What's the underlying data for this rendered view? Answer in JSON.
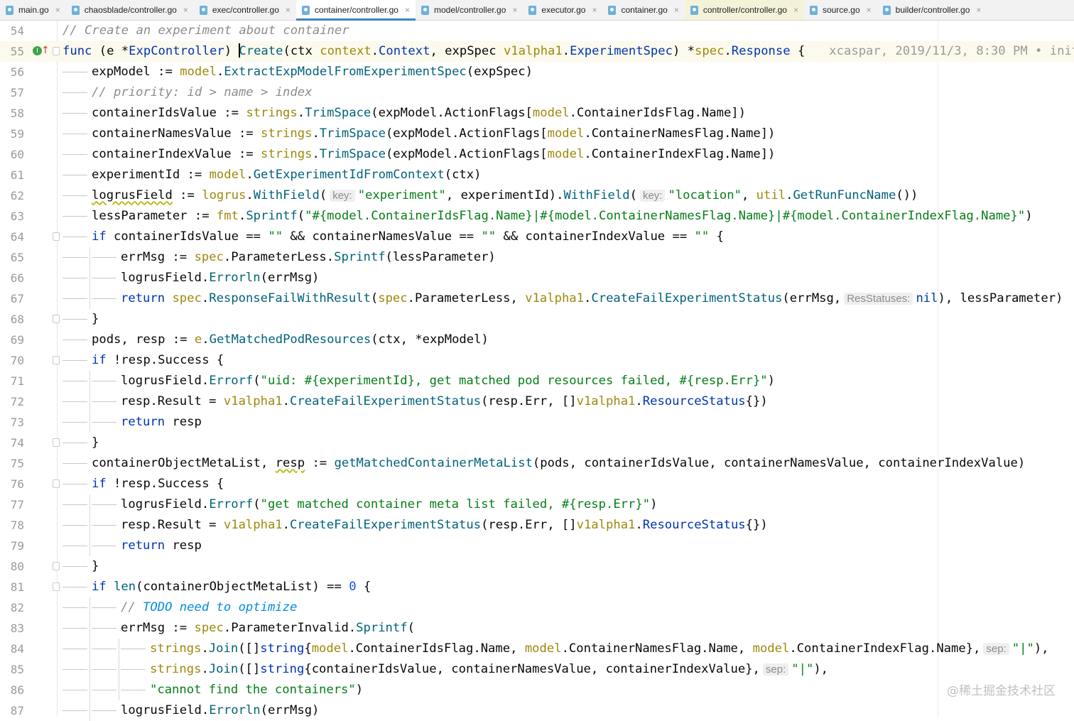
{
  "tabs": [
    {
      "label": "main.go",
      "active": false,
      "highlight": false
    },
    {
      "label": "chaosblade/controller.go",
      "active": false,
      "highlight": false
    },
    {
      "label": "exec/controller.go",
      "active": false,
      "highlight": false
    },
    {
      "label": "container/controller.go",
      "active": true,
      "highlight": false
    },
    {
      "label": "model/controller.go",
      "active": false,
      "highlight": false
    },
    {
      "label": "executor.go",
      "active": false,
      "highlight": false
    },
    {
      "label": "container.go",
      "active": false,
      "highlight": false
    },
    {
      "label": "controller/controller.go",
      "active": false,
      "highlight": true
    },
    {
      "label": "source.go",
      "active": false,
      "highlight": false
    },
    {
      "label": "builder/controller.go",
      "active": false,
      "highlight": false
    }
  ],
  "close_glyph": "×",
  "colors": {
    "keyword": "#0033b3",
    "string": "#067d17",
    "comment": "#8c8c8c",
    "package": "#9e880d",
    "function": "#00627a",
    "tab_active_underline": "#4083c9"
  },
  "editor": {
    "current_line": "55",
    "lines": [
      {
        "n": "54"
      },
      {
        "n": "55"
      },
      {
        "n": "56"
      },
      {
        "n": "57"
      },
      {
        "n": "58"
      },
      {
        "n": "59"
      },
      {
        "n": "60"
      },
      {
        "n": "61"
      },
      {
        "n": "62"
      },
      {
        "n": "63"
      },
      {
        "n": "64"
      },
      {
        "n": "65"
      },
      {
        "n": "66"
      },
      {
        "n": "67"
      },
      {
        "n": "68"
      },
      {
        "n": "69"
      },
      {
        "n": "70"
      },
      {
        "n": "71"
      },
      {
        "n": "72"
      },
      {
        "n": "73"
      },
      {
        "n": "74"
      },
      {
        "n": "75"
      },
      {
        "n": "76"
      },
      {
        "n": "77"
      },
      {
        "n": "78"
      },
      {
        "n": "79"
      },
      {
        "n": "80"
      },
      {
        "n": "81"
      },
      {
        "n": "82"
      },
      {
        "n": "83"
      },
      {
        "n": "84"
      },
      {
        "n": "85"
      },
      {
        "n": "86"
      },
      {
        "n": "87"
      }
    ],
    "text": {
      "l54_comment": "// Create an experiment about container",
      "l55_func": "func",
      "l55_recv": " (e *",
      "l55_recv_type": "ExpController",
      "l55_paren": ") ",
      "l55_name": "Create",
      "l55_params_a": "(ctx ",
      "l55_ctx_pkg": "context",
      "l55_dot": ".",
      "l55_ctx_type": "Context",
      "l55_params_b": ", expSpec ",
      "l55_spec_pkg": "v1alpha1",
      "l55_spec_type": "ExperimentSpec",
      "l55_params_c": ") *",
      "l55_ret_pkg": "spec",
      "l55_ret_type": "Response",
      "l55_brace": " {",
      "l55_blame": "xcaspar, 2019/11/3, 8:30 PM • init",
      "l56_a": "expModel := ",
      "l56_pkg": "model",
      "l56_fn": "ExtractExpModelFromExperimentSpec",
      "l56_b": "(expSpec)",
      "l57_comment": "// priority: id > name > index",
      "l58_a": "containerIdsValue := ",
      "l58_pkg": "strings",
      "l58_fn": "TrimSpace",
      "l58_b": "(expModel.ActionFlags[",
      "l58_pkg2": "model",
      "l58_c": ".ContainerIdsFlag.Name])",
      "l59_a": "containerNamesValue := ",
      "l59_pkg": "strings",
      "l59_fn": "TrimSpace",
      "l59_b": "(expModel.ActionFlags[",
      "l59_pkg2": "model",
      "l59_c": ".ContainerNamesFlag.Name])",
      "l60_a": "containerIndexValue := ",
      "l60_pkg": "strings",
      "l60_fn": "TrimSpace",
      "l60_b": "(expModel.ActionFlags[",
      "l60_pkg2": "model",
      "l60_c": ".ContainerIndexFlag.Name])",
      "l61_a": "experimentId := ",
      "l61_pkg": "model",
      "l61_fn": "GetExperimentIdFromContext",
      "l61_b": "(ctx)",
      "l62_a": "logrusField",
      "l62_b": " := ",
      "l62_pkg": "logrus",
      "l62_fn": "WithField",
      "l62_c": "(",
      "l62_hint1": "key:",
      "l62_str1": "\"experiment\"",
      "l62_d": ", experimentId).",
      "l62_fn2": "WithField",
      "l62_e": "(",
      "l62_hint2": "key:",
      "l62_str2": "\"location\"",
      "l62_f": ", ",
      "l62_pkg2": "util",
      "l62_fn3": "GetRunFuncName",
      "l62_g": "())",
      "l63_a": "lessParameter := ",
      "l63_pkg": "fmt",
      "l63_fn": "Sprintf",
      "l63_b": "(",
      "l63_str": "\"#{model.ContainerIdsFlag.Name}|#{model.ContainerNamesFlag.Name}|#{model.ContainerIndexFlag.Name}\"",
      "l63_c": ")",
      "l64_kw": "if",
      "l64_a": " containerIdsValue == ",
      "l64_s1": "\"\"",
      "l64_b": " && containerNamesValue == ",
      "l64_s2": "\"\"",
      "l64_c": " && containerIndexValue == ",
      "l64_s3": "\"\"",
      "l64_d": " {",
      "l65_a": "errMsg := ",
      "l65_pkg": "spec",
      "l65_b": ".ParameterLess.",
      "l65_fn": "Sprintf",
      "l65_c": "(lessParameter)",
      "l66_a": "logrusField.",
      "l66_fn": "Errorln",
      "l66_b": "(errMsg)",
      "l67_kw": "return",
      "l67_pkg": "spec",
      "l67_fn": "ResponseFailWithResult",
      "l67_a": "(",
      "l67_pkg2": "spec",
      "l67_b": ".ParameterLess, ",
      "l67_pkg3": "v1alpha1",
      "l67_fn2": "CreateFailExperimentStatus",
      "l67_c": "(errMsg,",
      "l67_hint": "ResStatuses:",
      "l67_nil": "nil",
      "l67_d": "), lessParameter)",
      "l68": "}",
      "l69_a": "pods, resp := ",
      "l69_pkg": "e",
      "l69_fn": "GetMatchedPodResources",
      "l69_b": "(ctx, *expModel)",
      "l70_kw": "if",
      "l70_a": " !resp.Success {",
      "l71_a": "logrusField.",
      "l71_fn": "Errorf",
      "l71_b": "(",
      "l71_str": "\"uid: #{experimentId}, get matched pod resources failed, #{resp.Err}\"",
      "l71_c": ")",
      "l72_a": "resp.Result = ",
      "l72_pkg": "v1alpha1",
      "l72_fn": "CreateFailExperimentStatus",
      "l72_b": "(resp.Err, []",
      "l72_pkg2": "v1alpha1",
      "l72_typ": "ResourceStatus",
      "l72_c": "{})",
      "l73_kw": "return",
      "l73_a": " resp",
      "l74": "}",
      "l75_a": "containerObjectMetaList, ",
      "l75_resp": "resp",
      "l75_b": " := ",
      "l75_fn": "getMatchedContainerMetaList",
      "l75_c": "(pods, containerIdsValue, containerNamesValue, containerIndexValue)",
      "l76_kw": "if",
      "l76_a": " !resp.Success {",
      "l77_a": "logrusField.",
      "l77_fn": "Errorf",
      "l77_b": "(",
      "l77_str": "\"get matched container meta list failed, #{resp.Err}\"",
      "l77_c": ")",
      "l78_a": "resp.Result = ",
      "l78_pkg": "v1alpha1",
      "l78_fn": "CreateFailExperimentStatus",
      "l78_b": "(resp.Err, []",
      "l78_pkg2": "v1alpha1",
      "l78_typ": "ResourceStatus",
      "l78_c": "{})",
      "l79_kw": "return",
      "l79_a": " resp",
      "l80": "}",
      "l81_kw": "if",
      "l81_fn": "len",
      "l81_a": "(containerObjectMetaList) == ",
      "l81_num": "0",
      "l81_b": " {",
      "l82_cm": "// ",
      "l82_todo": "TODO need to optimize",
      "l83_a": "errMsg := ",
      "l83_pkg": "spec",
      "l83_b": ".ParameterInvalid.",
      "l83_fn": "Sprintf",
      "l83_c": "(",
      "l84_pkg": "strings",
      "l84_fn": "Join",
      "l84_a": "([]",
      "l84_kw": "string",
      "l84_b": "{",
      "l84_pkg2": "model",
      "l84_c": ".ContainerIdsFlag.Name, ",
      "l84_pkg3": "model",
      "l84_d": ".ContainerNamesFlag.Name, ",
      "l84_pkg4": "model",
      "l84_e": ".ContainerIndexFlag.Name},",
      "l84_hint": "sep:",
      "l84_str": "\"|\"",
      "l84_f": "),",
      "l85_pkg": "strings",
      "l85_fn": "Join",
      "l85_a": "([]",
      "l85_kw": "string",
      "l85_b": "{containerIdsValue, containerNamesValue, containerIndexValue},",
      "l85_hint": "sep:",
      "l85_str": "\"|\"",
      "l85_c": "),",
      "l86_str": "\"cannot find the containers\"",
      "l86_a": ")",
      "l87_a": "logrusField.",
      "l87_fn": "Errorln",
      "l87_b": "(errMsg)"
    }
  },
  "watermark": "@稀土掘金技术社区"
}
